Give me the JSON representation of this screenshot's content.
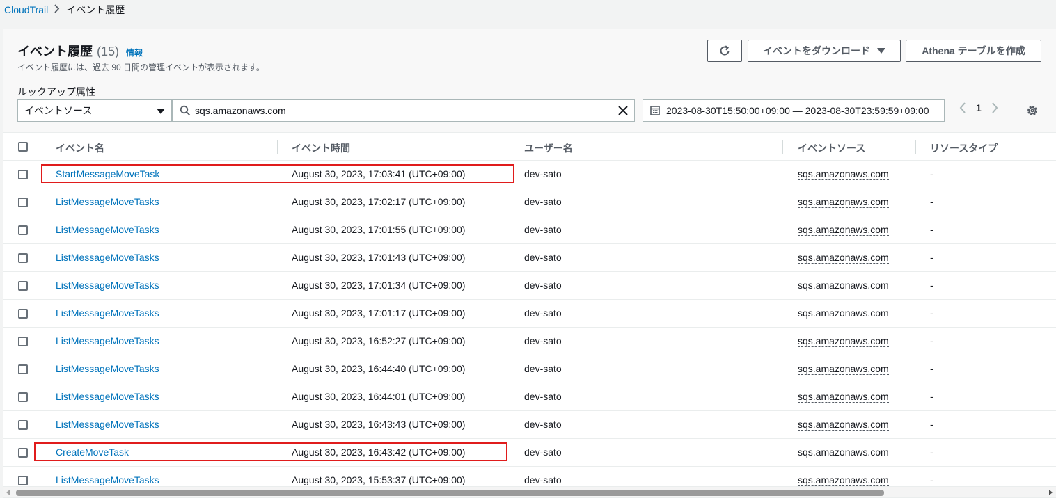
{
  "breadcrumb": {
    "root": "CloudTrail",
    "current": "イベント履歴"
  },
  "header": {
    "title": "イベント履歴",
    "count": "(15)",
    "info": "情報",
    "description": "イベント履歴には、過去 90 日間の管理イベントが表示されます。",
    "download_label": "イベントをダウンロード",
    "athena_label": "Athena テーブルを作成"
  },
  "filter": {
    "lookup_label": "ルックアップ属性",
    "attribute": "イベントソース",
    "search_value": "sqs.amazonaws.com",
    "date_range": "2023-08-30T15:50:00+09:00 — 2023-08-30T23:59:59+09:00"
  },
  "pagination": {
    "page": "1"
  },
  "table": {
    "columns": [
      "イベント名",
      "イベント時間",
      "ユーザー名",
      "イベントソース",
      "リソースタイプ"
    ],
    "rows": [
      {
        "name": "StartMessageMoveTask",
        "time": "August 30, 2023, 17:03:41 (UTC+09:00)",
        "user": "dev-sato",
        "source": "sqs.amazonaws.com",
        "resource": "-"
      },
      {
        "name": "ListMessageMoveTasks",
        "time": "August 30, 2023, 17:02:17 (UTC+09:00)",
        "user": "dev-sato",
        "source": "sqs.amazonaws.com",
        "resource": "-"
      },
      {
        "name": "ListMessageMoveTasks",
        "time": "August 30, 2023, 17:01:55 (UTC+09:00)",
        "user": "dev-sato",
        "source": "sqs.amazonaws.com",
        "resource": "-"
      },
      {
        "name": "ListMessageMoveTasks",
        "time": "August 30, 2023, 17:01:43 (UTC+09:00)",
        "user": "dev-sato",
        "source": "sqs.amazonaws.com",
        "resource": "-"
      },
      {
        "name": "ListMessageMoveTasks",
        "time": "August 30, 2023, 17:01:34 (UTC+09:00)",
        "user": "dev-sato",
        "source": "sqs.amazonaws.com",
        "resource": "-"
      },
      {
        "name": "ListMessageMoveTasks",
        "time": "August 30, 2023, 17:01:17 (UTC+09:00)",
        "user": "dev-sato",
        "source": "sqs.amazonaws.com",
        "resource": "-"
      },
      {
        "name": "ListMessageMoveTasks",
        "time": "August 30, 2023, 16:52:27 (UTC+09:00)",
        "user": "dev-sato",
        "source": "sqs.amazonaws.com",
        "resource": "-"
      },
      {
        "name": "ListMessageMoveTasks",
        "time": "August 30, 2023, 16:44:40 (UTC+09:00)",
        "user": "dev-sato",
        "source": "sqs.amazonaws.com",
        "resource": "-"
      },
      {
        "name": "ListMessageMoveTasks",
        "time": "August 30, 2023, 16:44:01 (UTC+09:00)",
        "user": "dev-sato",
        "source": "sqs.amazonaws.com",
        "resource": "-"
      },
      {
        "name": "ListMessageMoveTasks",
        "time": "August 30, 2023, 16:43:43 (UTC+09:00)",
        "user": "dev-sato",
        "source": "sqs.amazonaws.com",
        "resource": "-"
      },
      {
        "name": "CreateMoveTask",
        "time": "August 30, 2023, 16:43:42 (UTC+09:00)",
        "user": "dev-sato",
        "source": "sqs.amazonaws.com",
        "resource": "-"
      },
      {
        "name": "ListMessageMoveTasks",
        "time": "August 30, 2023, 15:53:37 (UTC+09:00)",
        "user": "dev-sato",
        "source": "sqs.amazonaws.com",
        "resource": "-"
      }
    ]
  },
  "colors": {
    "link": "#0073bb",
    "highlight": "#e01c1c"
  }
}
